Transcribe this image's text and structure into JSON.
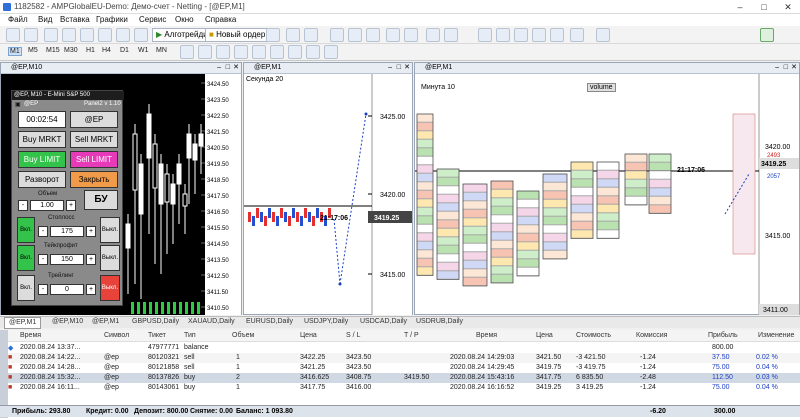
{
  "window": {
    "title": "1182582 - AMPGlobalEU-Demo: Демо-счет - Netting - [@EP,M1]",
    "min": "–",
    "max": "□",
    "close": "✕"
  },
  "menu": [
    "Файл",
    "Вид",
    "Вставка",
    "Графики",
    "Сервис",
    "Окно",
    "Справка"
  ],
  "toolbar": {
    "algo_label": "Алготрейдинг",
    "new_order_label": "Новый ордер",
    "timeframes": [
      "M1",
      "M5",
      "M15",
      "M30",
      "H1",
      "H4",
      "D1",
      "W1",
      "MN"
    ],
    "active_timeframe": "M1"
  },
  "panes": {
    "left": {
      "title": "@EP,M10"
    },
    "middle": {
      "title": "@EP,M1",
      "mode_label": "Секунда",
      "mode_value": "20",
      "price_tag": "3419.25",
      "time_tag": "21:17:06"
    },
    "right": {
      "title": "@EP,M1",
      "mode_label": "Минута",
      "mode_value": "10",
      "volume_label": "volume",
      "price_tag": "3419.25",
      "time_tag": "21:17:06",
      "bottom_price": "3411.00",
      "ask": "2493",
      "bid": "2057"
    }
  },
  "trade_panel": {
    "header": "@EP, M10 - E-Mini S&P 500",
    "panel_tag": "Panel2 v 1.10",
    "timer": "00:02:54",
    "symbol": "@EP",
    "buy_market": "Buy MRKT",
    "sell_market": "Sell MRKT",
    "buy_limit": "Buy LIMIT",
    "sell_limit": "Sell LIMIT",
    "reverse": "Разворот",
    "close": "Закрыть",
    "volume_label": "Объем",
    "volume_value": "1.00",
    "be_label": "БУ",
    "sl_label": "Стоплосс",
    "sl_value": "175",
    "tp_label": "Тейкпрофит",
    "tp_value": "150",
    "trail_label": "Трейлинг",
    "trail_value": "0",
    "on_label": "Вкл.",
    "off_label": "Выкл.",
    "minus": "-",
    "plus": "+"
  },
  "left_axis_labels": [
    "3424.50",
    "3423.50",
    "3422.50",
    "3421.50",
    "3420.50",
    "3419.50",
    "3418.50",
    "3417.50",
    "3416.50",
    "3415.50",
    "3414.50",
    "3413.50",
    "3412.50",
    "3411.50",
    "3410.50"
  ],
  "middle_axis_labels": [
    "3425.00",
    "3420.00",
    "3415.00"
  ],
  "right_axis_labels": [
    "3420.00",
    "3415.00"
  ],
  "chart_tabs": [
    "@EP,M1",
    "@EP,M10",
    "@EP,M1",
    "GBPUSD,Daily",
    "XAUAUD,Daily",
    "EURUSD,Daily",
    "USDJPY,Daily",
    "USDCAD,Daily",
    "USDRUB,Daily"
  ],
  "terminal": {
    "headers": [
      "Время",
      "Символ",
      "Тикет",
      "Тип",
      "Объем",
      "Цена",
      "S / L",
      "T / P",
      "Время",
      "Цена",
      "Стоимость",
      "Комиссия",
      "Прибыль",
      "Изменение"
    ],
    "rows": [
      [
        "2020.08.24 13:37...",
        "",
        "47977771",
        "balance",
        "",
        "",
        "",
        "",
        "",
        "",
        "",
        "",
        "800.00",
        ""
      ],
      [
        "2020.08.24 14:22...",
        "@ep",
        "80120321",
        "sell",
        "1",
        "3422.25",
        "3423.50",
        "",
        "2020.08.24 14:29:03",
        "3421.50",
        "-3 421.50",
        "-1.24",
        "37.50",
        "0.02 %"
      ],
      [
        "2020.08.24 14:28...",
        "@ep",
        "80121858",
        "sell",
        "1",
        "3421.25",
        "3423.50",
        "",
        "2020.08.24 14:29:45",
        "3419.75",
        "-3 419.75",
        "-1.24",
        "75.00",
        "0.04 %"
      ],
      [
        "2020.08.24 15:32...",
        "@ep",
        "80137826",
        "buy",
        "2",
        "3416.625",
        "3408.75",
        "3419.50",
        "2020.08.24 15:43:16",
        "3417.75",
        "6 835.50",
        "-2.48",
        "112.50",
        "0.03 %"
      ],
      [
        "2020.08.24 16:11...",
        "@ep",
        "80143061",
        "buy",
        "1",
        "3417.75",
        "3416.00",
        "",
        "2020.08.24 16:16:52",
        "3419.25",
        "3 419.25",
        "-1.24",
        "75.00",
        "0.04 %"
      ]
    ],
    "summary": {
      "profit": "Прибыль: 293.80",
      "credit": "Кредит: 0.00",
      "deposit": "Депозит: 800.00",
      "withdraw": "Снятие: 0.00",
      "balance": "Баланс: 1 093.80",
      "commission_total": "-6.20",
      "profit_total": "300.00"
    }
  }
}
